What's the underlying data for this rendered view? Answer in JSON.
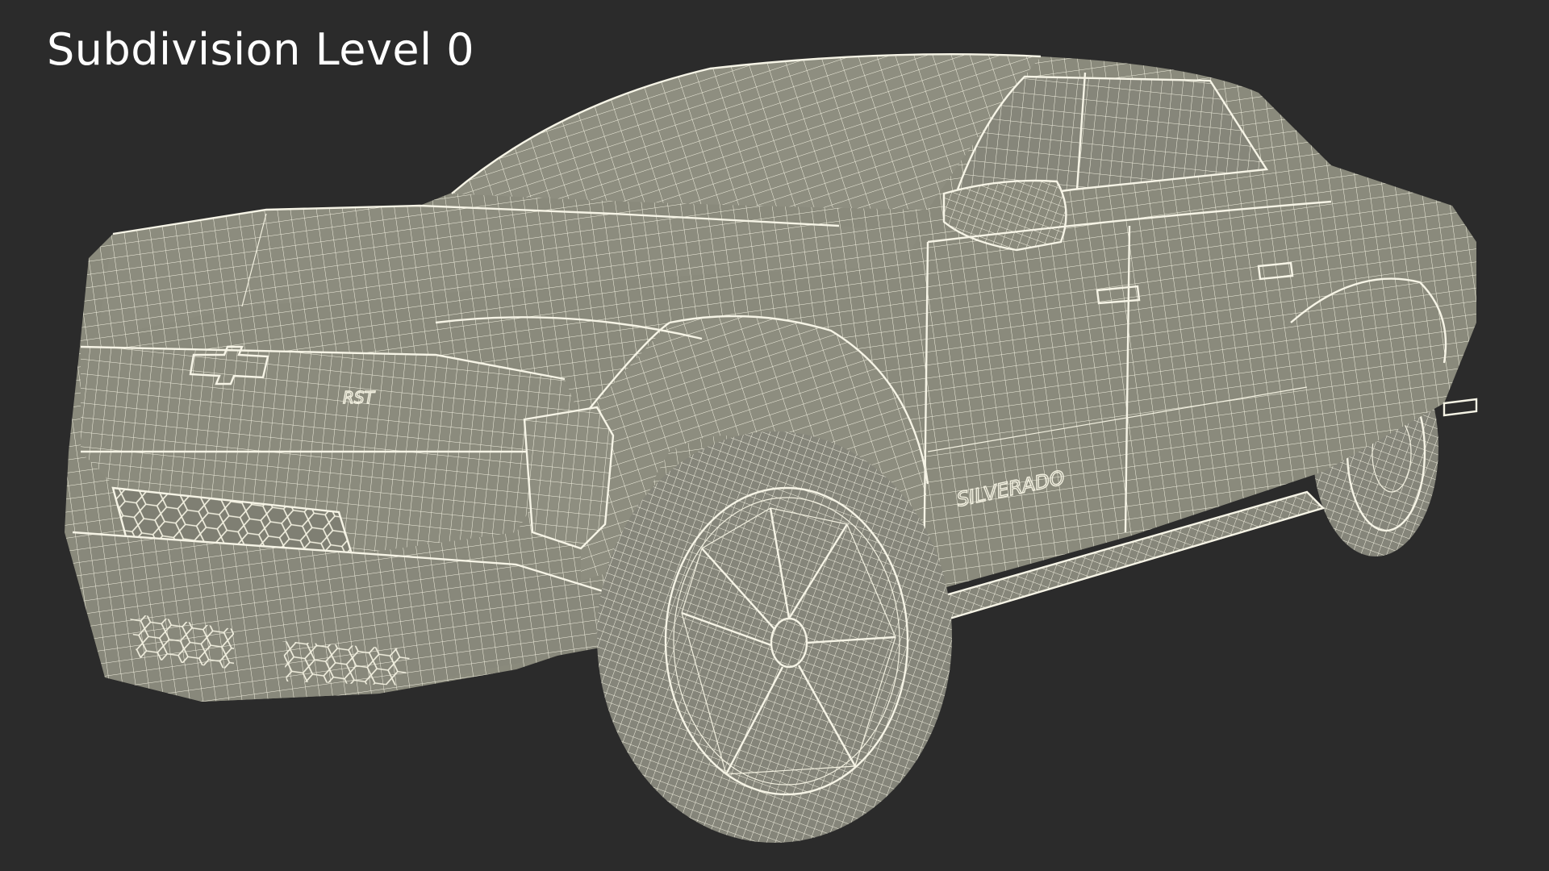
{
  "caption": "Subdivision Level 0",
  "colors": {
    "background": "#2b2b2b",
    "mesh_surface": "#8a8a7c",
    "wire": "#f2f0e0",
    "caption_text": "#ffffff"
  },
  "badges": {
    "side": "SILVERADO",
    "front": "RST"
  }
}
